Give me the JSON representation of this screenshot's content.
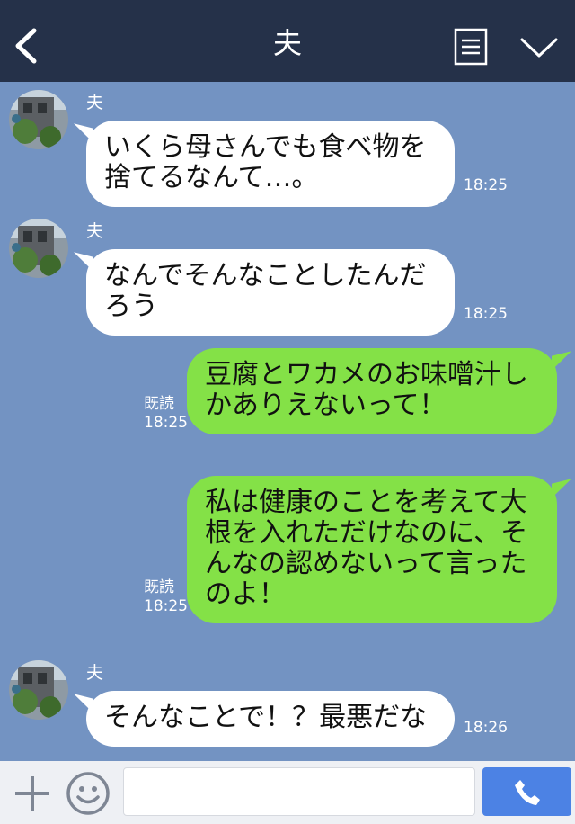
{
  "header": {
    "title": "夫"
  },
  "messages": [
    {
      "sender": "夫",
      "lines": [
        "いくら母さんでも食べ物を",
        "捨てるなんて…。"
      ],
      "time": "18:25"
    },
    {
      "sender": "夫",
      "lines": [
        "なんでそんなことしたんだ",
        "ろう"
      ],
      "time": "18:25"
    },
    {
      "lines": [
        "豆腐とワカメのお味噌汁し",
        "かありえないって！"
      ],
      "read": "既読",
      "time": "18:25"
    },
    {
      "lines": [
        "私は健康のことを考えて大",
        "根を入れただけなのに、そ",
        "んなの認めないって言った",
        "のよ！"
      ],
      "read": "既読",
      "time": "18:25"
    },
    {
      "sender": "夫",
      "lines": [
        "そんなことで！？最悪だな"
      ],
      "time": "18:26"
    }
  ],
  "footer": {
    "input_placeholder": ""
  },
  "colors": {
    "header_bg": "#253149",
    "chat_bg": "#7393c2",
    "incoming_bubble": "#ffffff",
    "outgoing_bubble": "#84e147",
    "call_button": "#4c82e4"
  },
  "icons": {
    "back": "chevron-left-icon",
    "menu": "menu-list-icon",
    "collapse": "chevron-down-icon",
    "add": "plus-icon",
    "sticker": "smiley-icon",
    "call": "phone-icon"
  }
}
